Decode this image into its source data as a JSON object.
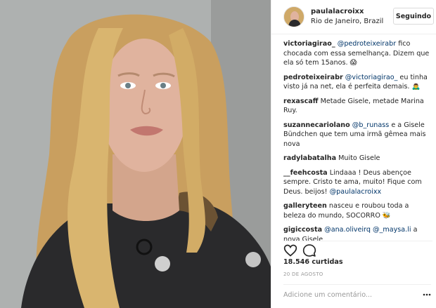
{
  "post": {
    "photo": {
      "subject": "selfie",
      "colors": {
        "background": "#b4b8b8",
        "hair": "#d9b56f",
        "jacket": "#2a2a2c"
      }
    }
  },
  "header": {
    "username": "paulalacroixx",
    "location": "Rio de Janeiro, Brazil",
    "follow_label": "Seguindo"
  },
  "comments": [
    {
      "user": "victoriagirao_",
      "mention": "@pedroteixeirabr",
      "text": " fico chocada com essa semelhança. Dizem que ela só tem 15anos. 😱"
    },
    {
      "user": "pedroteixeirabr",
      "mention": "@victoriagirao_",
      "text": " eu tinha visto já na net, ela é perfeita demais. 🙇‍♂️"
    },
    {
      "user": "rexascaff",
      "mention": "",
      "text": " Metade Gisele, metade Marina Ruy."
    },
    {
      "user": "suzannecariolano",
      "mention": "@b_runass",
      "text": " e a Gisele Bündchen que tem uma irmã gêmea mais nova"
    },
    {
      "user": "radylabatalha",
      "mention": "",
      "text": " Muito Gisele"
    },
    {
      "user": "__feehcosta",
      "mention": "",
      "text": " Lindaaa ! Deus abençoe sempre. Cristo te ama, muito! Fique com Deus. beijos! ",
      "mention_end": "@paulalacroixx"
    },
    {
      "user": "galleryteen",
      "mention": "",
      "text": " nasceu e roubou toda a beleza do mundo, SOCORRO 🐝"
    },
    {
      "user": "gigiccosta",
      "mention": "@ana.oliveirq",
      "text": " ",
      "mention2": "@_maysa.li",
      "text2": " a nova Gisele"
    }
  ],
  "actions": {
    "like_icon": "heart-icon",
    "comment_icon": "comment-bubble-icon"
  },
  "likes": "18.546 curtidas",
  "date": "20 DE AGOSTO",
  "add_comment": {
    "placeholder": "Adicione um comentário...",
    "more_icon": "more-options-icon"
  }
}
